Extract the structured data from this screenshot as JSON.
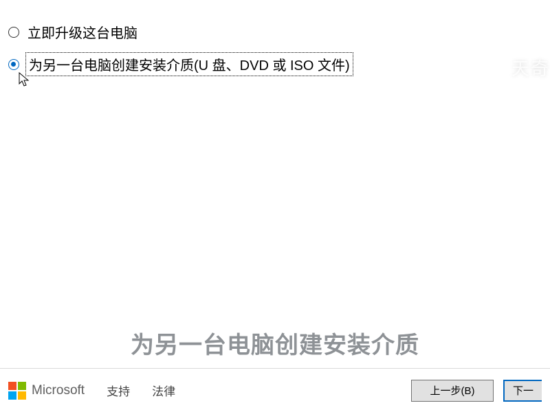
{
  "options": [
    {
      "label": "立即升级这台电脑",
      "selected": false
    },
    {
      "label": "为另一台电脑创建安装介质(U 盘、DVD 或 ISO 文件)",
      "selected": true
    }
  ],
  "watermark": "天奇",
  "caption": "为另一台电脑创建安装介质",
  "footer": {
    "brand": "Microsoft",
    "links": [
      "支持",
      "法律"
    ],
    "buttons": {
      "back": "上一步(B)",
      "next": "下一"
    }
  },
  "colors": {
    "accent": "#0067c0",
    "logo": {
      "red": "#f25022",
      "green": "#7fba00",
      "blue": "#00a4ef",
      "yellow": "#ffb900"
    }
  }
}
